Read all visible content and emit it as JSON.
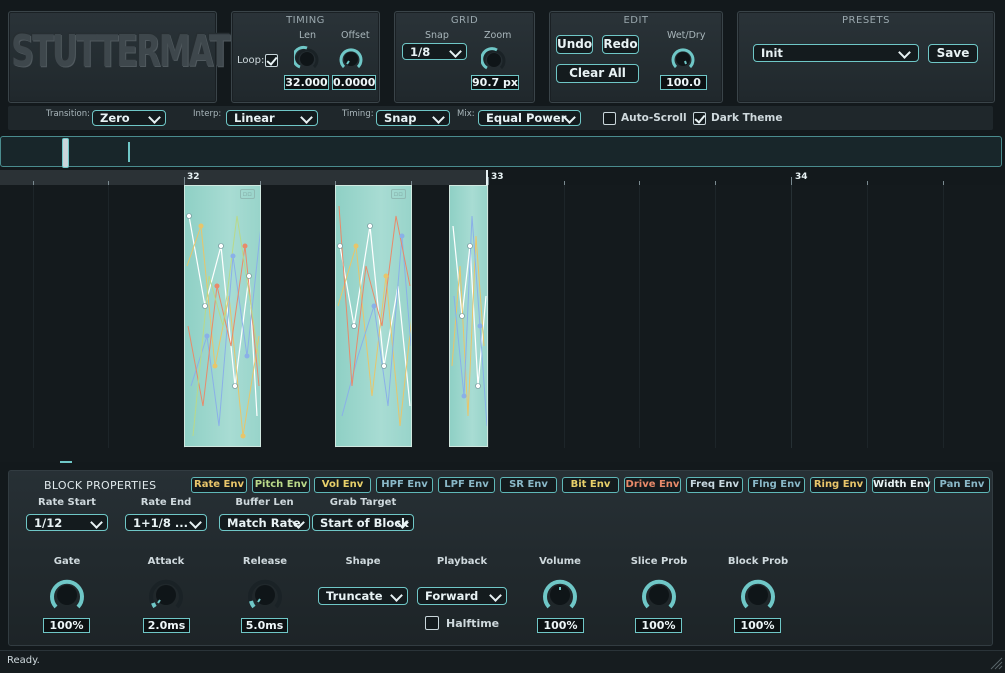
{
  "logo": "STUTTERMATION",
  "timing": {
    "title": "TIMING",
    "loop_label": "Loop:",
    "loop_checked": true,
    "len_label": "Len",
    "offset_label": "Offset",
    "len_value": "32.000",
    "offset_value": "0.0000..."
  },
  "grid": {
    "title": "GRID",
    "snap_label": "Snap",
    "zoom_label": "Zoom",
    "snap_value": "1/8",
    "zoom_value": "90.7 px"
  },
  "edit": {
    "title": "EDIT",
    "undo": "Undo",
    "redo": "Redo",
    "clear_all": "Clear All",
    "wetdry_label": "Wet/Dry",
    "wetdry_value": "100.0"
  },
  "presets": {
    "title": "PRESETS",
    "selected": "Init",
    "save": "Save"
  },
  "toolbar": {
    "transition_label": "Transition:",
    "transition_value": "Zero",
    "interp_label": "Interp:",
    "interp_value": "Linear",
    "timing_label": "Timing:",
    "timing_value": "Snap",
    "mix_label": "Mix:",
    "mix_value": "Equal Power",
    "autoscroll_label": "Auto-Scroll",
    "autoscroll_checked": false,
    "darktheme_label": "Dark Theme",
    "darktheme_checked": true
  },
  "ruler": {
    "markers": [
      "32",
      "33",
      "34"
    ]
  },
  "block_properties": {
    "title": "BLOCK PROPERTIES",
    "tabs": [
      {
        "label": "Rate Env",
        "color": "#e8c56a"
      },
      {
        "label": "Pitch Env",
        "color": "#b9d98a"
      },
      {
        "label": "Vol Env",
        "color": "#e8d06a"
      },
      {
        "label": "HPF Env",
        "color": "#8ab8c8"
      },
      {
        "label": "LPF Env",
        "color": "#8ab8c8"
      },
      {
        "label": "SR Env",
        "color": "#8ab8c8"
      },
      {
        "label": "Bit Env",
        "color": "#e8d06a"
      },
      {
        "label": "Drive Env",
        "color": "#e88a6a"
      },
      {
        "label": "Freq Env",
        "color": "#c8d8e0"
      },
      {
        "label": "Flng Env",
        "color": "#8ab8c8"
      },
      {
        "label": "Ring Env",
        "color": "#e8c56a"
      },
      {
        "label": "Width Env",
        "color": "#e8f2f4"
      },
      {
        "label": "Pan Env",
        "color": "#8ab8c8"
      }
    ],
    "rate_start_label": "Rate Start",
    "rate_start_value": "1/12",
    "rate_end_label": "Rate End",
    "rate_end_value": "1+1/8 ...",
    "buffer_len_label": "Buffer Len",
    "buffer_len_value": "Match Rate",
    "grab_target_label": "Grab Target",
    "grab_target_value": "Start of Block",
    "gate_label": "Gate",
    "gate_value": "100%",
    "attack_label": "Attack",
    "attack_value": "2.0ms",
    "release_label": "Release",
    "release_value": "5.0ms",
    "shape_label": "Shape",
    "shape_value": "Truncate",
    "playback_label": "Playback",
    "playback_value": "Forward",
    "halftime_label": "Halftime",
    "halftime_checked": false,
    "volume_label": "Volume",
    "volume_value": "100%",
    "slice_prob_label": "Slice Prob",
    "slice_prob_value": "100%",
    "block_prob_label": "Block Prob",
    "block_prob_value": "100%"
  },
  "status": "Ready.",
  "colors": {
    "accent": "#6fc7c7",
    "block_fill": "#a8dcd3",
    "background": "#13191c"
  }
}
